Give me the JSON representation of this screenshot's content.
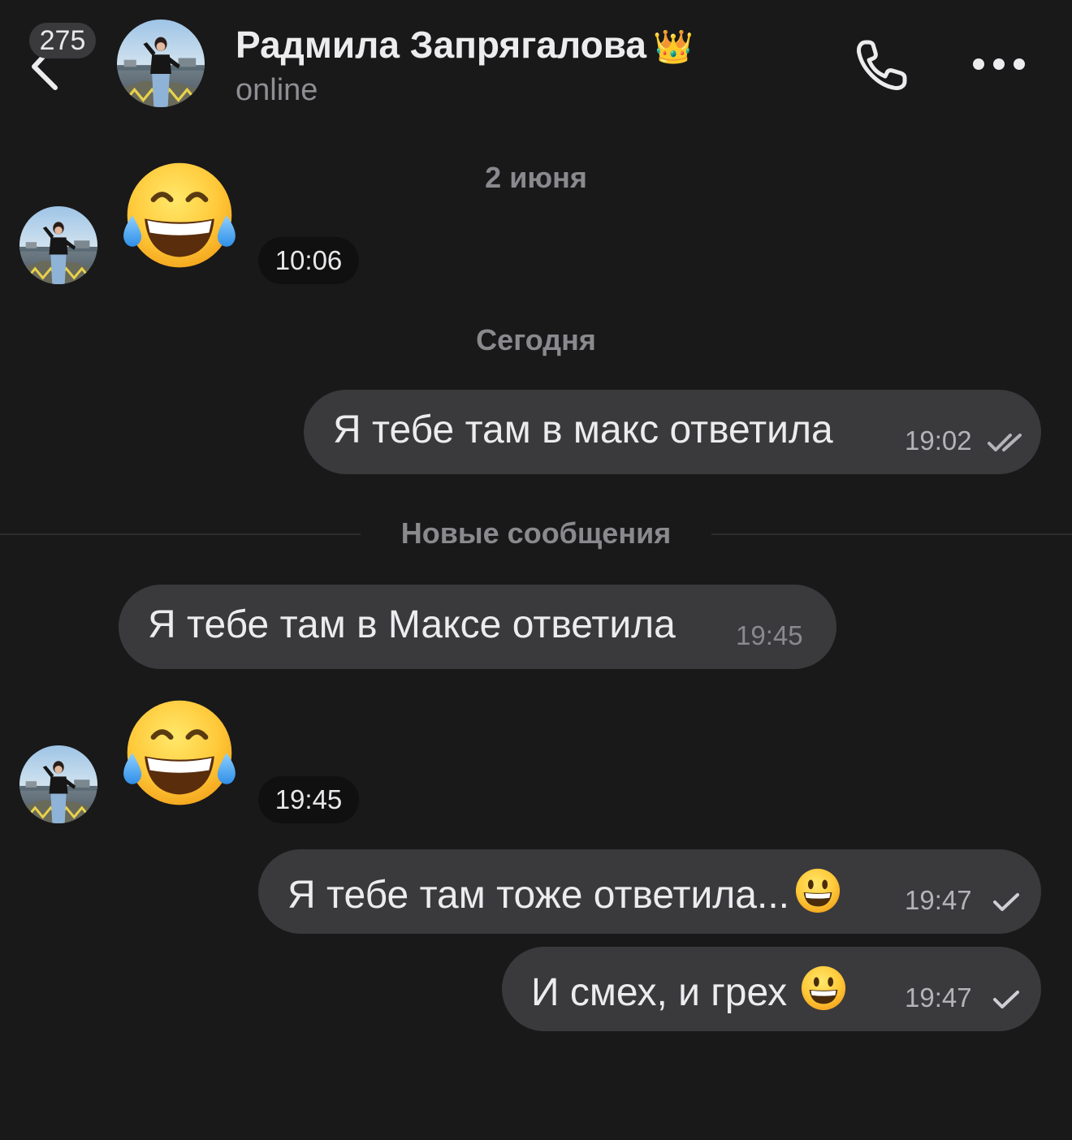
{
  "header": {
    "unread_count": "275",
    "contact_name": "Радмила Запрягалова",
    "contact_emoji": "👑",
    "status": "online"
  },
  "messages": {
    "date_1": "2 июня",
    "sticker_1_time": "10:06",
    "date_2": "Сегодня",
    "out_1": {
      "text": "Я тебе  там в макс ответила",
      "time": "19:02",
      "status": "read"
    },
    "new_messages_label": "Новые сообщения",
    "in_1": {
      "text": "Я тебе там в Максе ответила",
      "time": "19:45"
    },
    "sticker_2_time": "19:45",
    "out_2": {
      "text": "Я тебе там тоже ответила...",
      "time": "19:47",
      "status": "sent"
    },
    "out_3": {
      "text": "И смех, и грех",
      "time": "19:47",
      "status": "sent"
    }
  },
  "icons": {
    "back": "chevron-left-icon",
    "call": "phone-icon",
    "more": "more-horizontal-icon",
    "sticker": "face-with-tears-of-joy",
    "inline_emoji": "grinning-face"
  }
}
